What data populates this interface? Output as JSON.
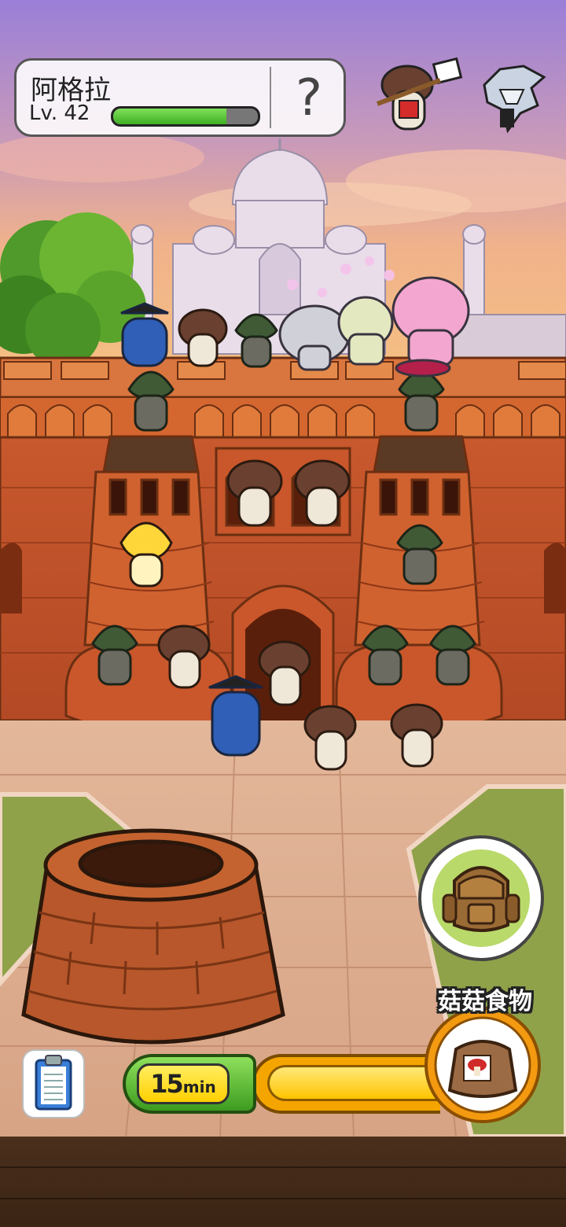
{
  "location": {
    "name": "阿格拉"
  },
  "level": {
    "label": "Lv. 42",
    "progress_percent": 78
  },
  "help": {
    "symbol": "?"
  },
  "food": {
    "label": "菇菇食物"
  },
  "timer": {
    "value": "15",
    "unit": "min"
  },
  "icons": {
    "help": "question-icon",
    "backpack": "backpack-icon",
    "food": "mushroom-food-bag-icon",
    "clipboard": "clipboard-icon",
    "mail_mushroom": "mail-mushroom-character-icon",
    "knight": "knight-character-icon"
  },
  "colors": {
    "xp_fill": "#4fc02c",
    "timer_tube": "#f5a500",
    "timer_bottle": "#5fbf35",
    "food_ring": "#f39a11"
  }
}
